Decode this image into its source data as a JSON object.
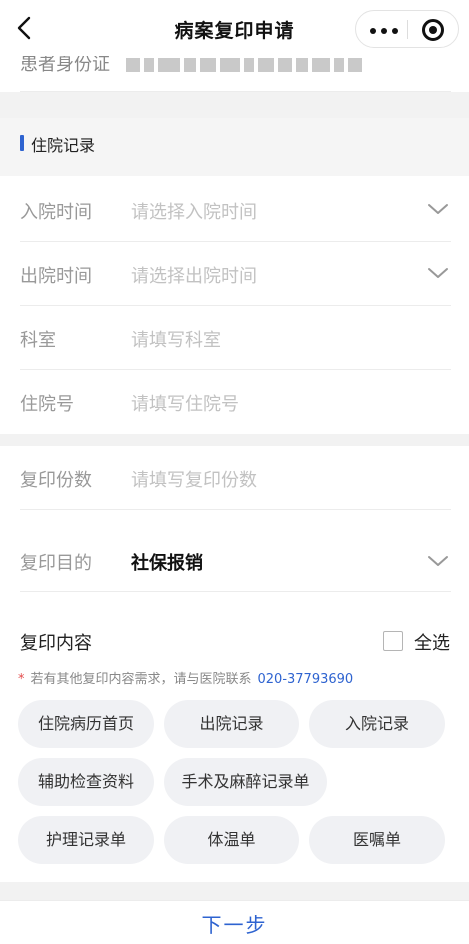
{
  "nav": {
    "title": "病案复印申请"
  },
  "patient": {
    "id_label": "患者身份证"
  },
  "section": {
    "title": "住院记录"
  },
  "fields": {
    "admit_label": "入院时间",
    "admit_placeholder": "请选择入院时间",
    "discharge_label": "出院时间",
    "discharge_placeholder": "请选择出院时间",
    "dept_label": "科室",
    "dept_placeholder": "请填写科室",
    "inpatient_label": "住院号",
    "inpatient_placeholder": "请填写住院号",
    "copies_label": "复印份数",
    "copies_placeholder": "请填写复印份数",
    "purpose_label": "复印目的",
    "purpose_value": "社保报销"
  },
  "content": {
    "label": "复印内容",
    "select_all": "全选",
    "note_star": "*",
    "note_text": "若有其他复印内容需求，请与医院联系",
    "note_phone": "020-37793690",
    "chips": [
      "住院病历首页",
      "出院记录",
      "入院记录",
      "辅助检查资料",
      "手术及麻醉记录单",
      "护理记录单",
      "体温单",
      "医嘱单"
    ]
  },
  "footer": {
    "next": "下一步"
  },
  "colors": {
    "accent": "#2e63d0",
    "required": "#e34c4c"
  }
}
